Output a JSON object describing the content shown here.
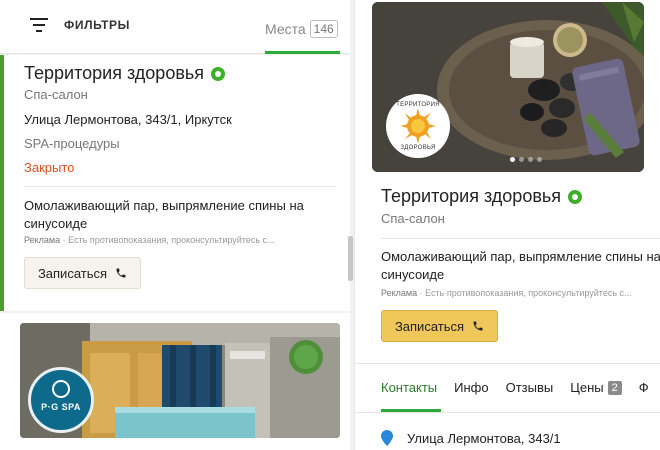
{
  "filters": {
    "label": "ФИЛЬТРЫ",
    "icon": "filter-icon"
  },
  "places": {
    "label": "Места",
    "count": "146"
  },
  "list_card": {
    "title": "Территория здоровья",
    "category": "Спа-салон",
    "address": "Улица Лермонтова, 343/1, Иркутск",
    "services": "SPA-процедуры",
    "status": "Закрыто",
    "description": "Омолаживающий пар, выпрямление спины на синусоиде",
    "ad_label": "Реклама",
    "ad_disclaimer": "Есть противопоказания, проконсультируйтесь с...",
    "book_label": "Записаться"
  },
  "list_card2": {
    "logo_text": "P·G SPA"
  },
  "detail": {
    "logo_text_top": "ТЕРРИТОРИЯ",
    "logo_text_bottom": "ЗДОРОВЬЯ",
    "title": "Территория здоровья",
    "category": "Спа-салон",
    "description": "Омолаживающий пар, выпрямление спины на синусоиде",
    "ad_label": "Реклама",
    "ad_disclaimer": "Есть противопоказания, проконсультируйтесь с...",
    "book_label": "Записаться",
    "tabs": [
      {
        "label": "Контакты",
        "active": true
      },
      {
        "label": "Инфо"
      },
      {
        "label": "Отзывы"
      },
      {
        "label": "Цены",
        "badge": "2"
      },
      {
        "label": "Ф"
      }
    ],
    "address": "Улица Лермонтова, 343/1"
  },
  "colors": {
    "accent_green": "#2eaa3c",
    "book_yellow": "#f0c75a",
    "closed_red": "#d9501e"
  }
}
